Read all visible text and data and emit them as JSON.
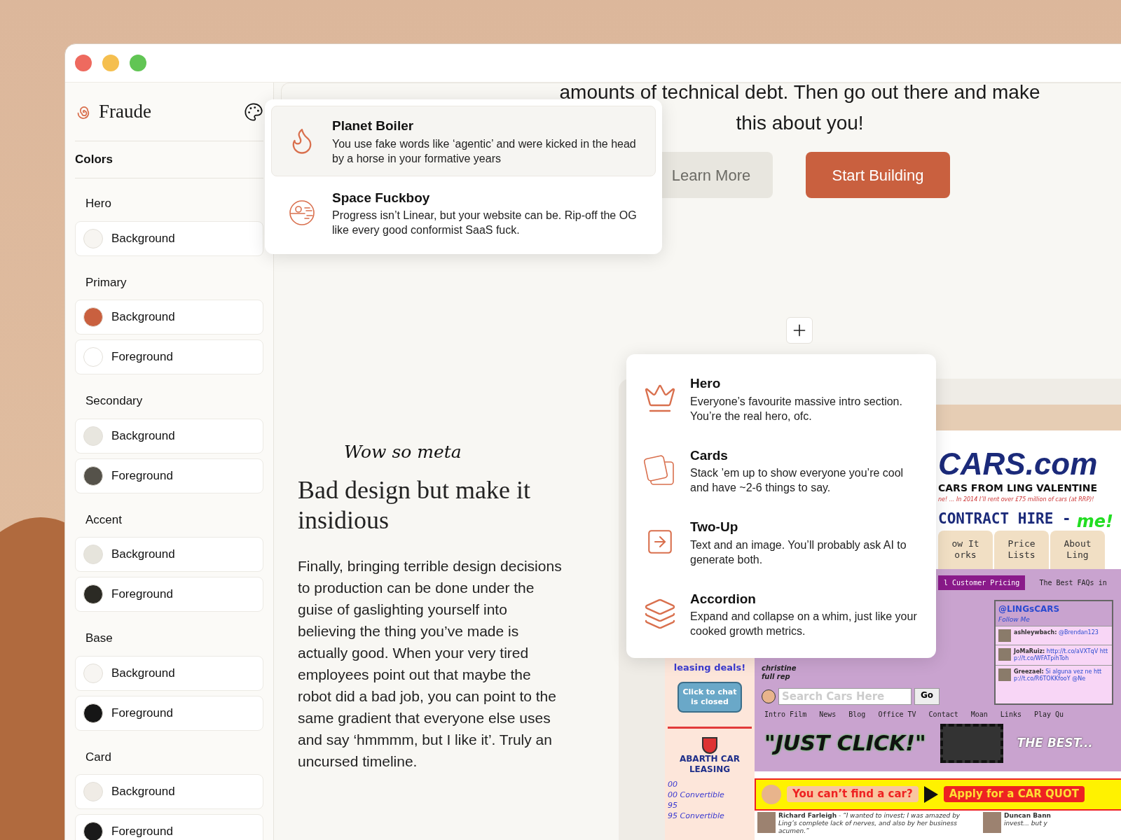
{
  "sidebar": {
    "brand": "Fraude",
    "section": "Colors",
    "groups": [
      {
        "label": "Hero",
        "swatches": [
          {
            "name": "Background",
            "color": "#f7f5f1"
          }
        ]
      },
      {
        "label": "Primary",
        "swatches": [
          {
            "name": "Background",
            "color": "#c9603f"
          },
          {
            "name": "Foreground",
            "color": "#ffffff"
          }
        ]
      },
      {
        "label": "Secondary",
        "swatches": [
          {
            "name": "Background",
            "color": "#e8e6df"
          },
          {
            "name": "Foreground",
            "color": "#55524a"
          }
        ]
      },
      {
        "label": "Accent",
        "swatches": [
          {
            "name": "Background",
            "color": "#e6e4dc"
          },
          {
            "name": "Foreground",
            "color": "#2b2a24"
          }
        ]
      },
      {
        "label": "Base",
        "swatches": [
          {
            "name": "Background",
            "color": "#f7f5f2"
          },
          {
            "name": "Foreground",
            "color": "#161616"
          }
        ]
      },
      {
        "label": "Card",
        "swatches": [
          {
            "name": "Background",
            "color": "#f0ece6"
          },
          {
            "name": "Foreground",
            "color": "#1a1a1a"
          }
        ]
      }
    ]
  },
  "hero": {
    "lines": [
      "amounts of technical debt. Then go out there and make",
      "this about you!"
    ],
    "buttons": [
      {
        "label": "Learn More",
        "kind": "secondary"
      },
      {
        "label": "Start Building",
        "kind": "primary"
      }
    ]
  },
  "theme_menu": {
    "items": [
      {
        "title": "Planet Boiler",
        "description": "You use fake words like ‘agentic’ and were kicked in the head by a horse in your formative years",
        "selected": true
      },
      {
        "title": "Space Fuckboy",
        "description": "Progress isn’t Linear, but your website can be. Rip-off the OG like every good conformist SaaS fuck.",
        "selected": false
      }
    ]
  },
  "section_menu": {
    "items": [
      {
        "title": "Hero",
        "description": "Everyone’s favourite massive intro section. You’re the real hero, ofc."
      },
      {
        "title": "Cards",
        "description": "Stack ’em up to show everyone you’re cool and have ~2-6 things to say."
      },
      {
        "title": "Two-Up",
        "description": "Text and an image. You’ll probably ask AI to generate both."
      },
      {
        "title": "Accordion",
        "description": "Expand and collapse on a whim, just like your cooked growth metrics."
      }
    ]
  },
  "feature": {
    "note": "Wow so meta",
    "heading": "Bad design but make it insidious",
    "body": "Finally, bringing terrible design decisions to production can be done under the guise of gaslighting yourself into believing the thing you’ve made is actually good. When your very tired employees point out that maybe the robot did a bad job, you can point to the same gradient that everyone else uses and say ‘hmmmm, but I like it’. Truly an uncursed timeline."
  },
  "embedded_site": {
    "logo": "CARS.com",
    "tagline": "CARS FROM LING VALENTINE",
    "promo": "ne! ... In 2014 I’ll rent over £75 million of cars (at RRP)!",
    "headline": "CONTRACT HIRE -",
    "scribble": "me!",
    "tabs": [
      "ow It\norks",
      "Price\nLists",
      "About\nLing"
    ],
    "subtabs": [
      {
        "label": "l Customer Pricing",
        "selected": true
      },
      {
        "label": "The Best FAQs in",
        "selected": false
      }
    ],
    "twitter": {
      "handle": "@LINGsCARS",
      "follow": "Follow Me",
      "tweets": [
        {
          "author": "ashleywbach:",
          "text": "@Brendan123"
        },
        {
          "author": "JoMaRuiz:",
          "text": "http://t.co/aVXTqV http://t.co/WFATpihToh"
        },
        {
          "author": "Greezael:",
          "text": "Si alguna vez ne http://t.co/R6TOKKfooY @Ne"
        }
      ]
    },
    "caption": "christine full rep",
    "search": {
      "placeholder": "Search Cars Here",
      "button": "Go"
    },
    "nav": [
      "Intro Film",
      "News",
      "Blog",
      "Office TV",
      "Contact",
      "Moan",
      "Links",
      "Play Qu"
    ],
    "slogan": "\"JUST CLICK!\"",
    "badge": "THE BEST...",
    "sidebar": {
      "deals": "leasing deals!",
      "chat": "Click to chat is closed",
      "heading": "ABARTH CAR LEASING",
      "prices": [
        "00",
        "00 Convertible",
        "95",
        "95 Convertible"
      ]
    },
    "banner": {
      "question": "You can’t find a car?",
      "cta": "Apply for a CAR QUOT"
    },
    "testimonials": [
      {
        "name": "Richard Farleigh",
        "quote": "- “I wanted to invest; I was amazed by Ling’s complete lack of nerves, and also by her business acumen.”"
      },
      {
        "name": "Duncan Bann",
        "quote": "invest... but y"
      }
    ]
  }
}
